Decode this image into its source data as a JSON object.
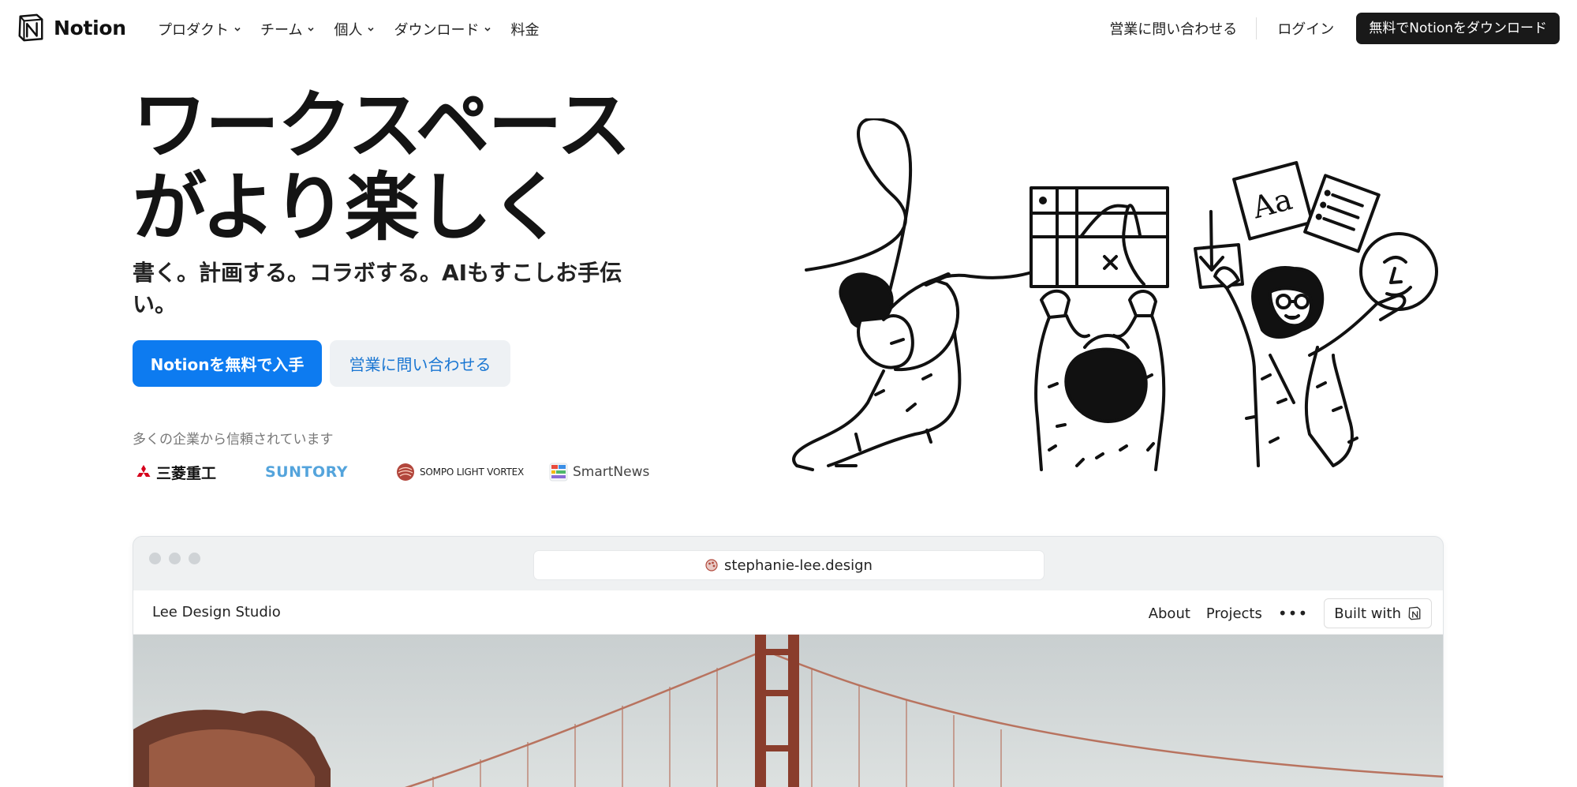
{
  "nav": {
    "brand": "Notion",
    "items": [
      {
        "label": "プロダクト",
        "has_dropdown": true
      },
      {
        "label": "チーム",
        "has_dropdown": true
      },
      {
        "label": "個人",
        "has_dropdown": true
      },
      {
        "label": "ダウンロード",
        "has_dropdown": true
      },
      {
        "label": "料金",
        "has_dropdown": false
      }
    ],
    "sales_label": "営業に問い合わせる",
    "login_label": "ログイン",
    "cta_label": "無料でNotionをダウンロード"
  },
  "hero": {
    "title_line1": "ワークスペース",
    "title_line2": "がより楽しく",
    "subtitle": "書く。計画する。コラボする。AIもすこしお手伝い。",
    "primary_button": "Notionを無料で入手",
    "secondary_button": "営業に問い合わせる",
    "trust_text": "多くの企業から信頼されています",
    "companies": [
      "三菱重工",
      "SUNTORY",
      "SOMPO LIGHT VORTEX",
      "SmartNews"
    ]
  },
  "browser": {
    "url": "stephanie-lee.design",
    "site_title": "Lee Design Studio",
    "site_nav": [
      "About",
      "Projects"
    ],
    "more_label": "•••",
    "built_with_label": "Built with"
  },
  "colors": {
    "primary": "#0d7bf0",
    "dark": "#191919",
    "secondary_bg": "#eef1f4",
    "link_blue": "#1976d2"
  }
}
